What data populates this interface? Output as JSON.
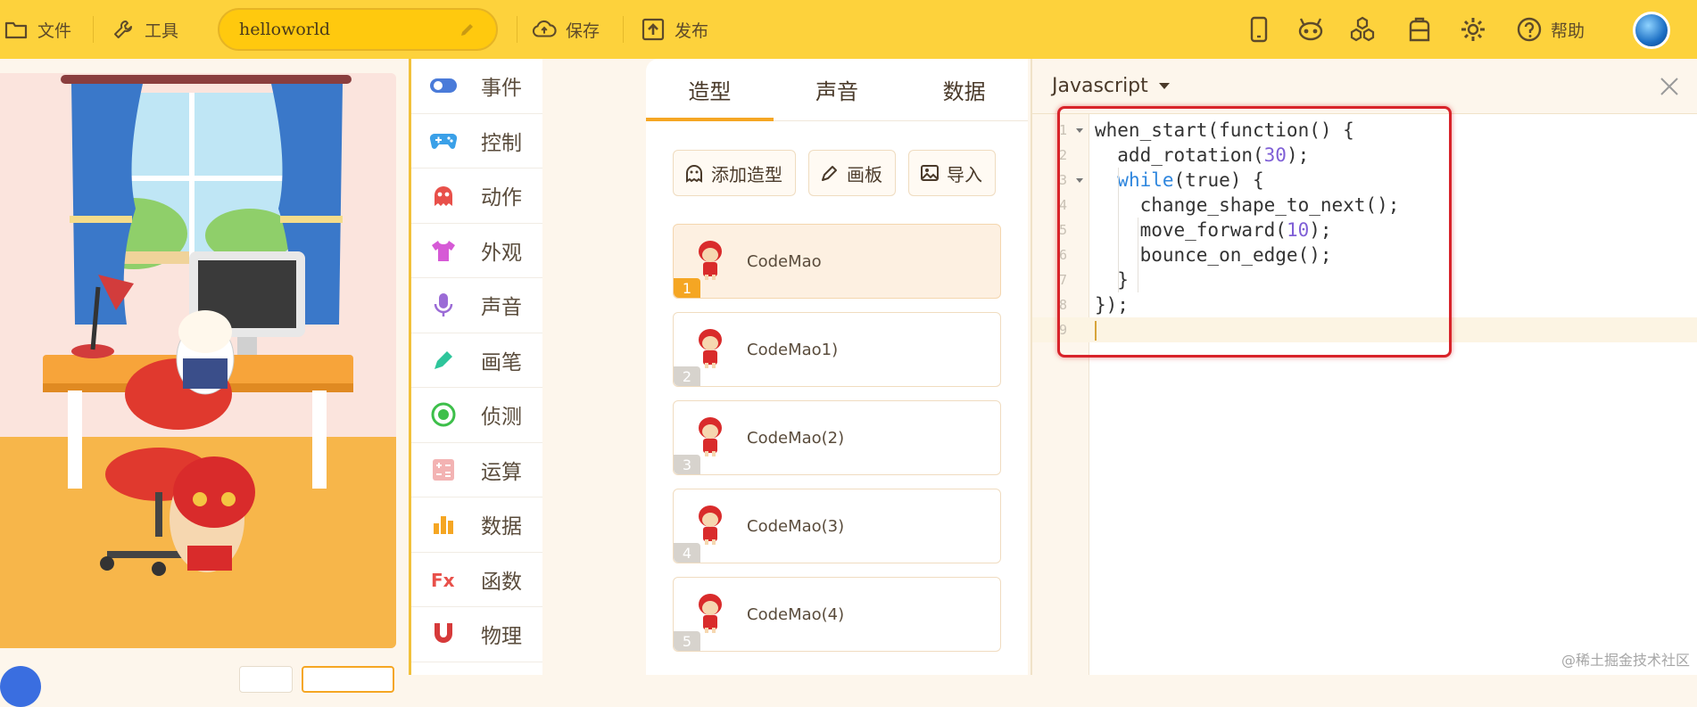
{
  "topbar": {
    "file_label": "文件",
    "tools_label": "工具",
    "project_name": "helloworld",
    "save_label": "保存",
    "publish_label": "发布",
    "help_label": "帮助"
  },
  "categories": [
    {
      "label": "事件",
      "color": "#4a7bd9"
    },
    {
      "label": "控制",
      "color": "#3aa0e8"
    },
    {
      "label": "动作",
      "color": "#e8504a"
    },
    {
      "label": "外观",
      "color": "#d65ad6"
    },
    {
      "label": "声音",
      "color": "#9b6bd6"
    },
    {
      "label": "画笔",
      "color": "#2ec59b"
    },
    {
      "label": "侦测",
      "color": "#3dbf4a"
    },
    {
      "label": "运算",
      "color": "#f0a0a0"
    },
    {
      "label": "数据",
      "color": "#f5a623"
    },
    {
      "label": "函数",
      "color": "#e8504a"
    },
    {
      "label": "物理",
      "color": "#d63a3a"
    }
  ],
  "costume_panel": {
    "tabs": [
      "造型",
      "声音",
      "数据"
    ],
    "active_tab": 0,
    "tools": [
      "添加造型",
      "画板",
      "导入"
    ],
    "costumes": [
      {
        "name": "CodeMao",
        "num": "1",
        "selected": true
      },
      {
        "name": "CodeMao1)",
        "num": "2",
        "selected": false
      },
      {
        "name": "CodeMao(2)",
        "num": "3",
        "selected": false
      },
      {
        "name": "CodeMao(3)",
        "num": "4",
        "selected": false
      },
      {
        "name": "CodeMao(4)",
        "num": "5",
        "selected": false
      }
    ]
  },
  "code_panel": {
    "language": "Javascript",
    "lines": [
      {
        "n": "1",
        "fold": true,
        "text": "when_start(function() {"
      },
      {
        "n": "2",
        "fold": false,
        "text": "  add_rotation(30);"
      },
      {
        "n": "3",
        "fold": true,
        "text": "  while(true) {"
      },
      {
        "n": "4",
        "fold": false,
        "text": "    change_shape_to_next();"
      },
      {
        "n": "5",
        "fold": false,
        "text": "    move_forward(10);"
      },
      {
        "n": "6",
        "fold": false,
        "text": "    bounce_on_edge();"
      },
      {
        "n": "7",
        "fold": false,
        "text": "  }"
      },
      {
        "n": "8",
        "fold": false,
        "text": "});"
      },
      {
        "n": "9",
        "fold": false,
        "text": ""
      }
    ]
  },
  "watermark": "@稀土掘金技术社区",
  "colors": {
    "accent": "#fdd23c",
    "tab_active": "#f5a623",
    "highlight": "#d8232a"
  }
}
